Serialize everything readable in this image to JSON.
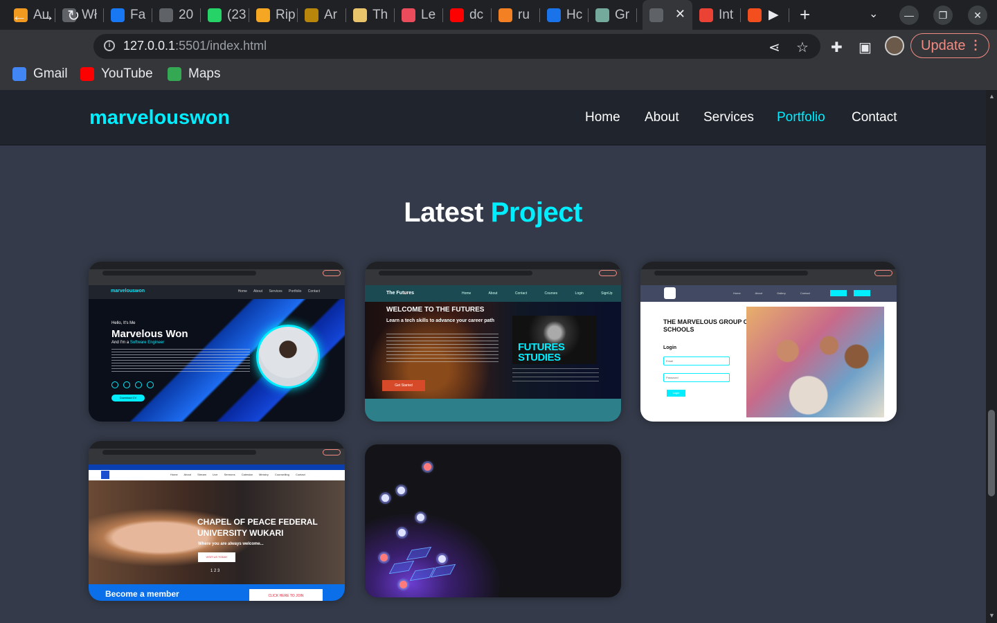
{
  "browser": {
    "tabs": [
      {
        "label": "Au",
        "icon": "audible-icon",
        "color": "#f29a1f"
      },
      {
        "label": "Wł",
        "icon": "globe-icon",
        "color": "#5f6368"
      },
      {
        "label": "Fa",
        "icon": "facebook-icon",
        "color": "#1877f2"
      },
      {
        "label": "20",
        "icon": "globe-icon",
        "color": "#5f6368"
      },
      {
        "label": "(23",
        "icon": "whatsapp-icon",
        "color": "#25d366"
      },
      {
        "label": "Rip",
        "icon": "replit-icon",
        "color": "#f5a623"
      },
      {
        "label": "Ar",
        "icon": "animal-icon",
        "color": "#b8860b"
      },
      {
        "label": "Th",
        "icon": "image-icon",
        "color": "#e9c46a"
      },
      {
        "label": "Le",
        "icon": "leetcode-icon",
        "color": "#ea4c5c"
      },
      {
        "label": "dc",
        "icon": "youtube-icon",
        "color": "#ff0000"
      },
      {
        "label": "ru",
        "icon": "stackoverflow-icon",
        "color": "#f48024"
      },
      {
        "label": "Hc",
        "icon": "spinner-icon",
        "color": "#1a73e8"
      },
      {
        "label": "Gr",
        "icon": "chatgpt-icon",
        "color": "#74aa9c"
      },
      {
        "label": "",
        "icon": "globe-icon",
        "color": "#5f6368"
      },
      {
        "label": "Int",
        "icon": "gmail-icon",
        "color": "#ea4335"
      },
      {
        "label": "",
        "icon": "figma-icon",
        "color": "#f24e1e"
      }
    ],
    "new_tab": "+",
    "address": {
      "host": "127.0.0.1",
      "path": ":5501/index.html"
    },
    "update_label": "Update",
    "bookmarks": [
      {
        "label": "Gmail",
        "icon": "google-icon",
        "color": "#4285f4"
      },
      {
        "label": "YouTube",
        "icon": "youtube-icon",
        "color": "#ff0000"
      },
      {
        "label": "Maps",
        "icon": "maps-icon",
        "color": "#34a853"
      }
    ]
  },
  "site": {
    "brand": "marvelouswon",
    "accent": "#00eeff",
    "nav": [
      {
        "label": "Home",
        "active": false
      },
      {
        "label": "About",
        "active": false
      },
      {
        "label": "Services",
        "active": false
      },
      {
        "label": "Portfolio",
        "active": true
      },
      {
        "label": "Contact",
        "active": false
      }
    ],
    "heading": {
      "main": "Latest",
      "accent": "Project"
    }
  },
  "projects": [
    {
      "nav_brand": "marvelouswon",
      "nav_links": "Home About Services Portfolio Contact",
      "hello": "Hello, It's Me",
      "name": "Marvelous Won",
      "role_prefix": "And I'm a",
      "role": "Software Engineer",
      "button": "Download CV"
    },
    {
      "nav_brand": "The Futures",
      "nav_links": "Home About Contact Courses Login SignUp",
      "title": "WELCOME TO THE FUTURES",
      "subtitle": "Learn a tech skills to advance your career path",
      "logo_text": "FUTURES STUDIES",
      "button": "Get Started"
    },
    {
      "nav_links": "Home About Gallery Contact",
      "title": "THE MARVELOUS GROUP OF SCHOOLS",
      "login": "Login",
      "email_placeholder": "Email",
      "password_placeholder": "Password",
      "button": "Login"
    },
    {
      "nav_links": "Home About Stream Live Sermons Calendar Ministry Counselling Contact",
      "title": "CHAPEL OF PEACE FEDERAL UNIVERSITY WUKARI",
      "subtitle": "Where you are always welcome...",
      "button": "VISIT US TODAY",
      "pager": "1 2 3",
      "become": "Become a member",
      "join": "CLICK HERE TO JOIN"
    },
    {}
  ]
}
